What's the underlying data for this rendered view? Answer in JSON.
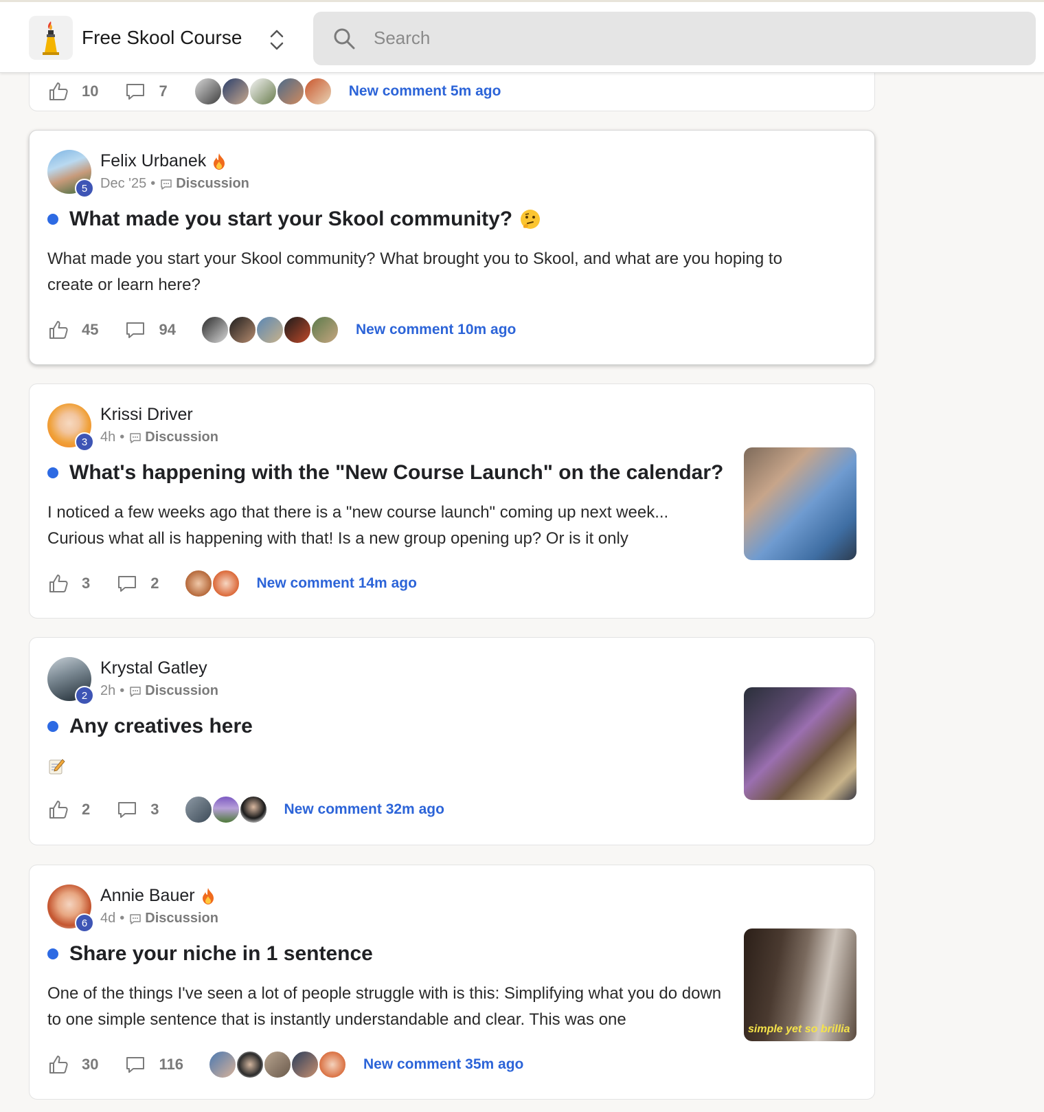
{
  "header": {
    "community_name": "Free Skool Course",
    "search_placeholder": "Search"
  },
  "partial_post": {
    "likes": "10",
    "comments": "7",
    "new_comment": "New comment 5m ago"
  },
  "posts": [
    {
      "author": "Felix Urbanek",
      "level": "5",
      "time": "Dec '25",
      "category": "Discussion",
      "title": "What made you start your Skool community?",
      "body": "What made you start your Skool community? What brought you to Skool, and what are you hoping to create or learn here?",
      "likes": "45",
      "comments": "94",
      "new_comment": "New comment 10m ago"
    },
    {
      "author": "Krissi Driver",
      "level": "3",
      "time": "4h",
      "category": "Discussion",
      "title": "What's happening with the \"New Course Launch\" on the calendar?",
      "body": "I noticed a few weeks ago that there is a \"new course launch\" coming up next week... Curious what all is happening with that! Is a new group opening up? Or is it only",
      "likes": "3",
      "comments": "2",
      "new_comment": "New comment 14m ago"
    },
    {
      "author": "Krystal Gatley",
      "level": "2",
      "time": "2h",
      "category": "Discussion",
      "title": "Any creatives here",
      "likes": "2",
      "comments": "3",
      "new_comment": "New comment 32m ago"
    },
    {
      "author": "Annie Bauer",
      "level": "6",
      "time": "4d",
      "category": "Discussion",
      "title": "Share your niche in 1 sentence",
      "body": "One of the things I've seen a lot of people struggle with is this: Simplifying what you do down to one simple sentence that is instantly understandable and clear. This was one",
      "likes": "30",
      "comments": "116",
      "new_comment": "New comment 35m ago",
      "thumb_caption": "simple yet so brillia"
    }
  ],
  "colors": {
    "accent_blue": "#2c64d8",
    "unread_dot": "#2d6ae3",
    "level_badge": "#3e55b5"
  },
  "icons": [
    "torch-logo-icon",
    "chevron-up-down-icon",
    "search-icon",
    "thumbs-up-icon",
    "comment-icon",
    "fire-icon",
    "speech-bubble-icon",
    "thinking-face-icon",
    "memo-icon"
  ]
}
